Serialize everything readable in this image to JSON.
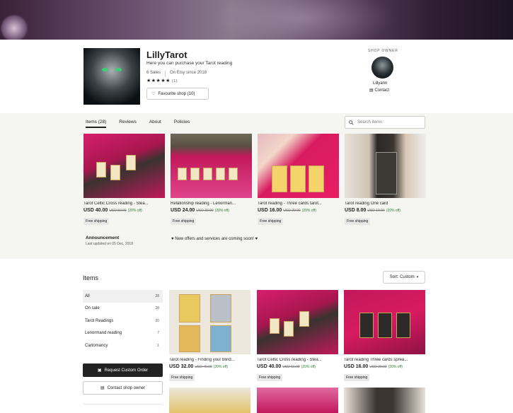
{
  "shop": {
    "name": "LillyTarot",
    "tagline": "Here you can purchase your Tarot reading",
    "sales": "6 Sales",
    "since": "On Etsy since 2018",
    "stars": "★★★★★",
    "review_count": "(1)",
    "favourite_label": "Favourite shop (10)"
  },
  "owner": {
    "label": "SHOP OWNER",
    "name": "Lillyann",
    "contact_label": "Contact"
  },
  "tabs": [
    {
      "label": "Items (28)",
      "active": true
    },
    {
      "label": "Reviews",
      "active": false
    },
    {
      "label": "About",
      "active": false
    },
    {
      "label": "Policies",
      "active": false
    }
  ],
  "search": {
    "placeholder": "Search items"
  },
  "featured": [
    {
      "title": "Tarot Celtic Cross reading - Stea...",
      "price": "USD 40.00",
      "old_price": "USD 50.00",
      "discount": "(20% off)",
      "shipping": "Free shipping"
    },
    {
      "title": "Relationship reading - Lenorman...",
      "price": "USD 24.00",
      "old_price": "USD 30.00",
      "discount": "(20% off)",
      "shipping": "Free shipping"
    },
    {
      "title": "Tarot reading - Three cards tarot...",
      "price": "USD 16.00",
      "old_price": "USD 20.00",
      "discount": "(20% off)",
      "shipping": "Free shipping"
    },
    {
      "title": "Tarot reading One card",
      "price": "USD 8.00",
      "old_price": "USD 10.00",
      "discount": "(20% off)",
      "shipping": "Free shipping"
    }
  ],
  "announcement": {
    "title": "Announcement",
    "updated": "Last updated on 05 Dec, 2018",
    "text": "♥ New offers and services are coming soon! ♥"
  },
  "items_section": {
    "heading": "Items",
    "sort_label": "Sort: Custom"
  },
  "categories": [
    {
      "label": "All",
      "count": "28",
      "active": true
    },
    {
      "label": "On sale",
      "count": "28",
      "active": false
    },
    {
      "label": "Tarot Readings",
      "count": "20",
      "active": false
    },
    {
      "label": "Lenormand reading",
      "count": "7",
      "active": false
    },
    {
      "label": "Cartomancy",
      "count": "1",
      "active": false
    }
  ],
  "sidebar_buttons": {
    "request_custom": "Request Custom Order",
    "contact_owner": "Contact shop owner"
  },
  "grid": [
    {
      "title": "Tarot reading - Finding your blind...",
      "price": "USD 32.00",
      "old_price": "USD 40.00",
      "discount": "(20% off)",
      "shipping": "Free shipping"
    },
    {
      "title": "Tarot Celtic Cross reading - Stea...",
      "price": "USD 40.00",
      "old_price": "USD 50.00",
      "discount": "(20% off)",
      "shipping": "Free shipping"
    },
    {
      "title": "Tarot reading Three cards sprea...",
      "price": "USD 16.00",
      "old_price": "USD 20.00",
      "discount": "(20% off)",
      "shipping": "Free shipping"
    }
  ],
  "colors": {
    "accent_pink": "#d61f6e",
    "discount_green": "#2e7d32",
    "dark_button": "#222222",
    "strip_bg": "#f5f5f1"
  },
  "icons": [
    "heart-icon",
    "message-icon",
    "search-icon",
    "chevron-down-icon",
    "star-icon"
  ]
}
